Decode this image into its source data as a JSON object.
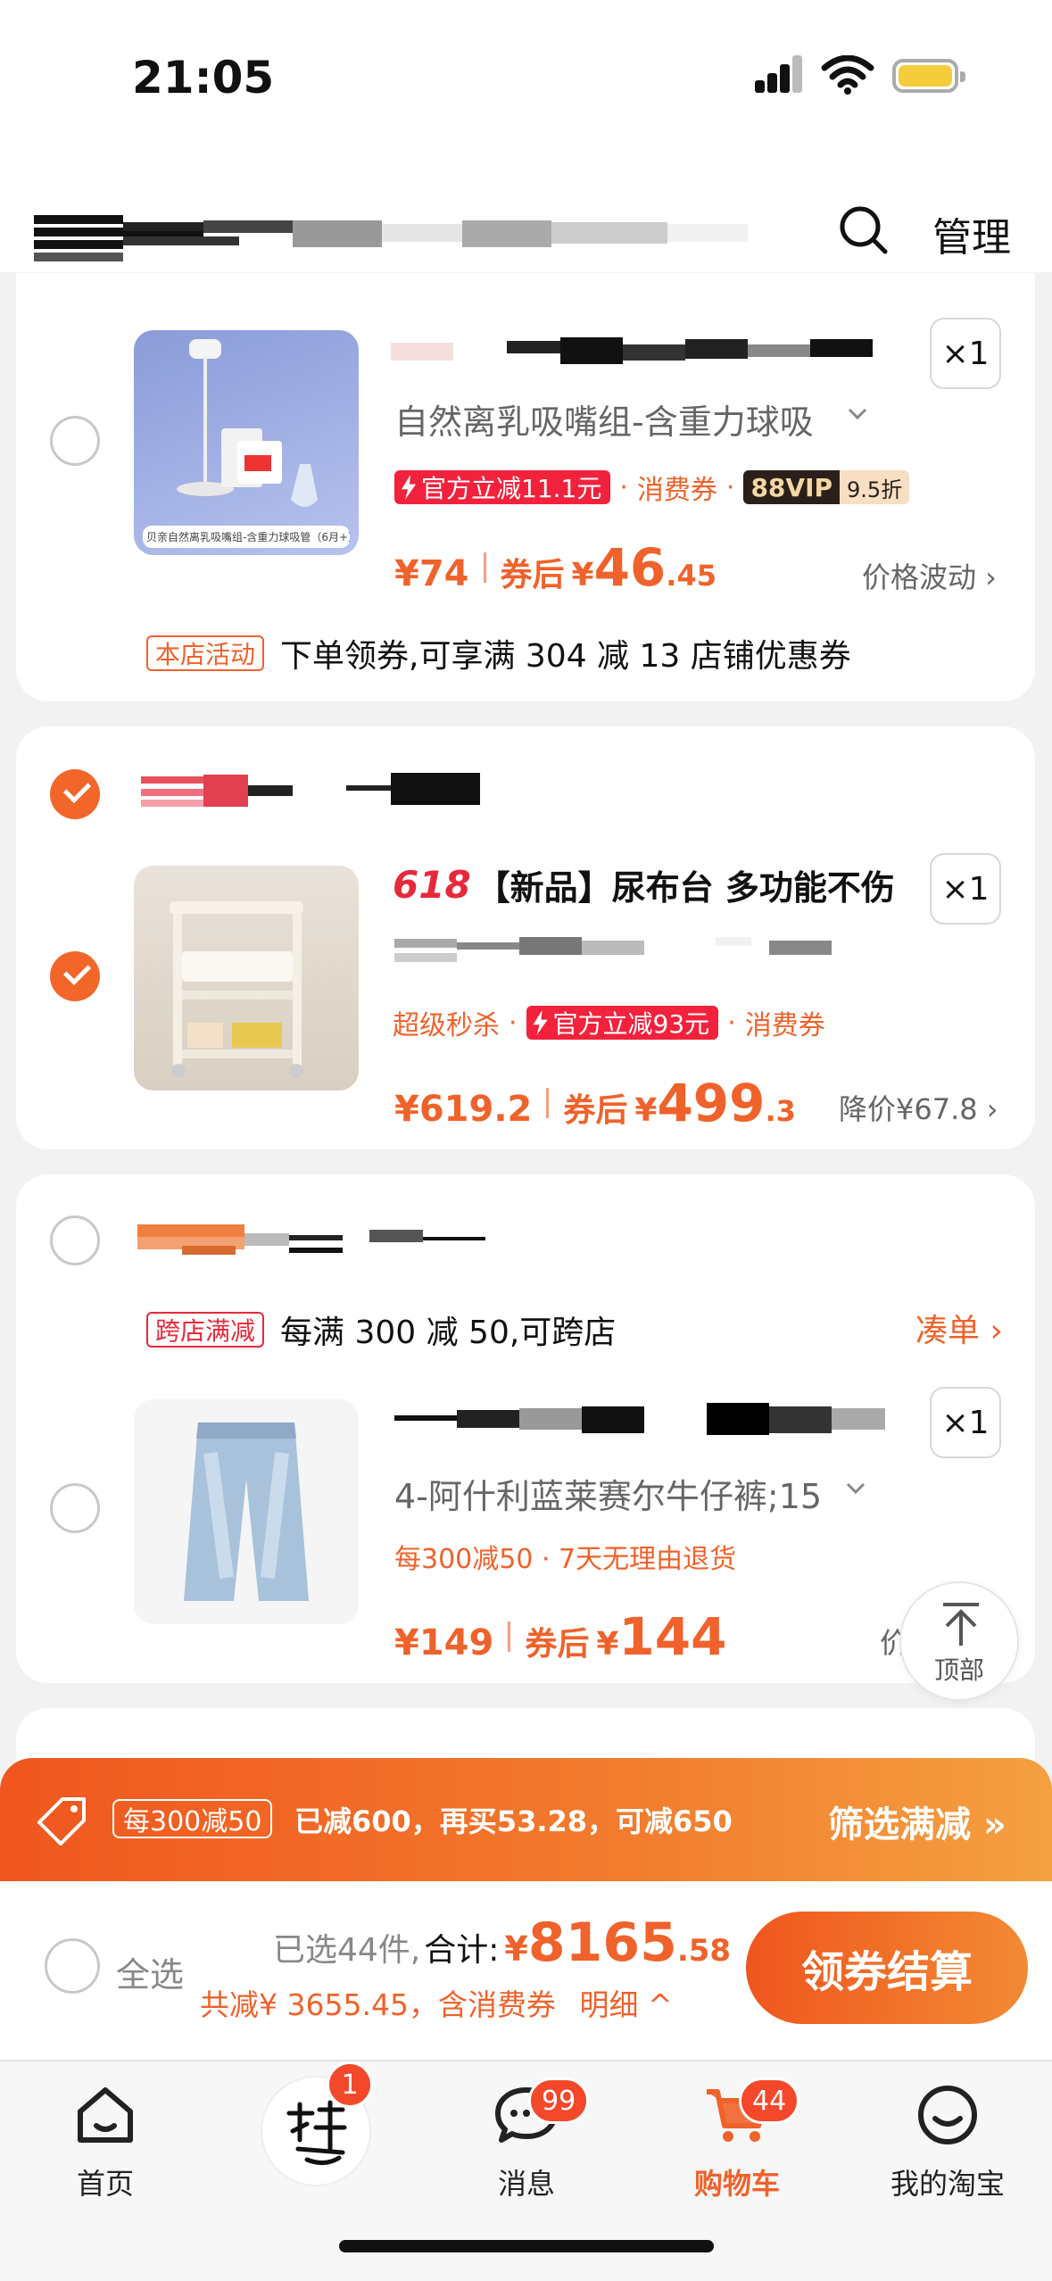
{
  "status_bar": {
    "time": "21:05"
  },
  "header": {
    "manage_label": "管理"
  },
  "items": [
    {
      "sku": "自然离乳吸嘴组-含重力球吸",
      "qty": "×1",
      "badge_official": "官方立减11.1元",
      "coupon": "消费券",
      "vip_label": "88VIP",
      "vip_discount": "9.5折",
      "price": "¥74",
      "after_label": "券后",
      "after_yen": "¥",
      "after_int": "46",
      "after_dec": ".45",
      "side_note": "价格波动 ›",
      "shop_tag": "本店活动",
      "shop_promo": "下单领券,可享满 304 减 13 店铺优惠券",
      "thumb_caption": "贝亲自然离乳吸嘴组-含重力球吸管（6月+）"
    },
    {
      "title_prefix": "618",
      "title": "【新品】尿布台 多功能不伤",
      "qty": "×1",
      "flash_sale": "超级秒杀",
      "badge_official": "官方立减93元",
      "coupon": "消费券",
      "price": "¥619.2",
      "after_label": "券后",
      "after_yen": "¥",
      "after_int": "499",
      "after_dec": ".3",
      "side_note": "降价¥67.8 ›"
    },
    {
      "cross_tag": "跨店满减",
      "cross_promo": "每满 300 减 50,可跨店",
      "cross_link": "凑单 ›",
      "sku": "4-阿什利蓝莱赛尔牛仔裤;15",
      "qty": "×1",
      "promo": "每300减50 · 7天无理由退货",
      "price": "¥149",
      "after_label": "券后",
      "after_yen": "¥",
      "after_int": "144",
      "after_dec": "",
      "side_note": "价格"
    }
  ],
  "top_button": {
    "label": "顶部"
  },
  "promo_bar": {
    "tag": "每300减50",
    "message": "已减600，再买53.28，可减650",
    "filter": "筛选满减 »"
  },
  "checkout": {
    "select_all": "全选",
    "selected": "已选44件,",
    "total_label": "合计:",
    "yen": "¥",
    "amount_int": "8165",
    "amount_dec": ".58",
    "discount": "共减¥ 3655.45，含消费券",
    "detail": "明细 ^",
    "pay_label": "领券结算"
  },
  "tabs": [
    {
      "label": "首页",
      "badge": ""
    },
    {
      "label": "",
      "badge": "1"
    },
    {
      "label": "消息",
      "badge": "99"
    },
    {
      "label": "购物车",
      "badge": "44"
    },
    {
      "label": "我的淘宝",
      "badge": ""
    }
  ],
  "colors": {
    "accent": "#f0622b",
    "tab_active": "#f0622b",
    "checked": "#f3662a"
  }
}
